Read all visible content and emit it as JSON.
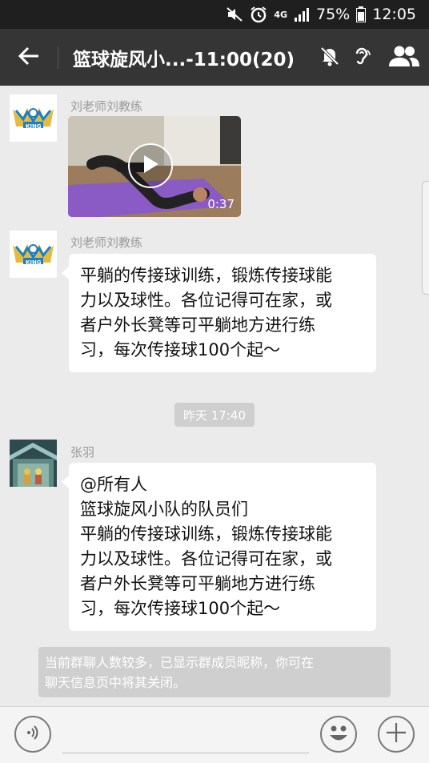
{
  "status_bar": {
    "network": "4G",
    "battery": "75%",
    "time": "12:05"
  },
  "header": {
    "title": "篮球旋风小...-11:00(20)"
  },
  "messages": [
    {
      "sender": "刘老师刘教练",
      "avatar_text": "KING",
      "video_duration": "0:37"
    },
    {
      "sender": "刘老师刘教练",
      "avatar_text": "KING",
      "lines": [
        "平躺的传接球训练，锻炼传接球能",
        "力以及球性。各位记得可在家，或",
        "者户外长凳等可平躺地方进行练",
        "习，每次传接球100个起～"
      ]
    },
    {
      "sender": "张羽",
      "lines": [
        "@所有人",
        "篮球旋风小队的队员们",
        "平躺的传接球训练，锻炼传接球能",
        "力以及球性。各位记得可在家，或",
        "者户外长凳等可平躺地方进行练",
        "习，每次传接球100个起～"
      ]
    }
  ],
  "timestamp": "昨天 17:40",
  "system_notice": {
    "line1": "当前群聊人数较多，已显示群成员昵称，你可在",
    "line2": "聊天信息页中将其关闭。"
  },
  "colors": {
    "status_bar_bg": "#1f1f1f",
    "title_bar_bg": "#353535",
    "chat_bg": "#ebebeb",
    "bubble_bg": "#ffffff",
    "logo_blue": "#1c7fc0",
    "logo_gold": "#e1b42b"
  },
  "icons": [
    "mute-icon",
    "alarm-icon",
    "signal-icon",
    "battery-icon",
    "back-arrow-icon",
    "bell-off-icon",
    "ear-icon",
    "group-members-icon",
    "play-icon",
    "voice-icon",
    "emoji-icon",
    "plus-icon"
  ]
}
